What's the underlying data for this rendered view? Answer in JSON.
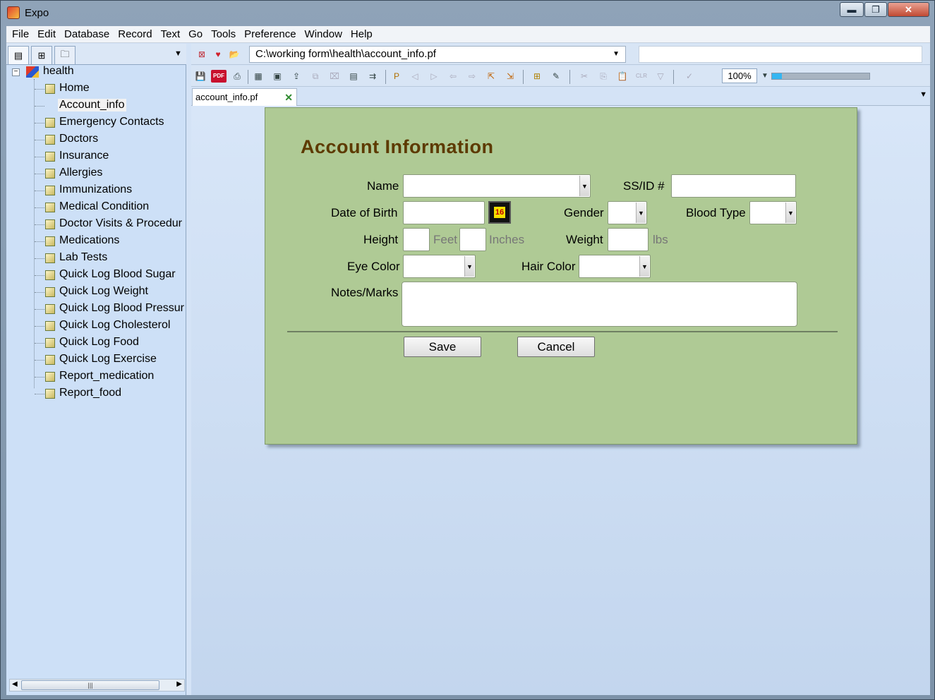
{
  "window": {
    "title": "Expo",
    "minimize": "▬",
    "maximize": "❐",
    "close": "✕"
  },
  "menu": [
    "File",
    "Edit",
    "Database",
    "Record",
    "Text",
    "Go",
    "Tools",
    "Preference",
    "Window",
    "Help"
  ],
  "tree": {
    "root": "health",
    "items": [
      "Home",
      "Account_info",
      "Emergency Contacts",
      "Doctors",
      "Insurance",
      "Allergies",
      "Immunizations",
      "Medical Condition",
      "Doctor Visits & Procedur",
      "Medications",
      "Lab Tests",
      "Quick Log Blood Sugar",
      "Quick Log Weight",
      "Quick Log Blood Pressur",
      "Quick Log Cholesterol",
      "Quick Log Food",
      "Quick Log Exercise",
      "Report_medication",
      "Report_food"
    ],
    "selected": "Account_info"
  },
  "path": {
    "value": "C:\\working form\\health\\account_info.pf",
    "secondary_value": ""
  },
  "toolbar": {
    "zoom": "100%",
    "zoom_slider_level": 0.1
  },
  "tab": {
    "label": "account_info.pf"
  },
  "form": {
    "title": "Account  Information",
    "labels": {
      "name": "Name",
      "ssid": "SS/ID #",
      "dob": "Date of Birth",
      "gender": "Gender",
      "blood_type": "Blood Type",
      "height": "Height",
      "feet": "Feet",
      "inches": "Inches",
      "weight": "Weight",
      "lbs": "lbs",
      "eye_color": "Eye Color",
      "hair_color": "Hair Color",
      "notes": "Notes/Marks"
    },
    "calendar_day": "16",
    "values": {
      "name": "",
      "ssid": "",
      "dob": "",
      "gender": "",
      "blood_type": "",
      "feet": "",
      "inches": "",
      "weight": "",
      "eye_color": "",
      "hair_color": "",
      "notes": ""
    },
    "buttons": {
      "save": "Save",
      "cancel": "Cancel"
    }
  },
  "colors": {
    "form_bg": "#afca95",
    "title_color": "#5d3a00",
    "panel_bg": "#cde0f7"
  }
}
